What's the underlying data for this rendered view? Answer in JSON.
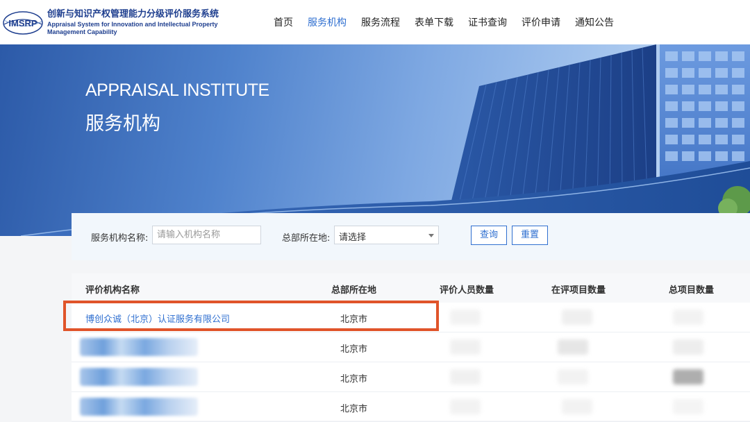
{
  "header": {
    "logo_text": "IMSRP",
    "brand_cn": "创新与知识产权管理能力分级评价服务系统",
    "brand_en_line1": "Appraisal System for Innovation and Intellectual Property",
    "brand_en_line2": "Management Capability",
    "nav": [
      {
        "label": "首页"
      },
      {
        "label": "服务机构"
      },
      {
        "label": "服务流程"
      },
      {
        "label": "表单下载"
      },
      {
        "label": "证书查询"
      },
      {
        "label": "评价申请"
      },
      {
        "label": "通知公告"
      }
    ],
    "active_nav": "服务机构"
  },
  "banner": {
    "title_en": "APPRAISAL INSTITUTE",
    "title_cn": "服务机构"
  },
  "search": {
    "name_label": "服务机构名称:",
    "name_placeholder": "请输入机构名称",
    "location_label": "总部所在地:",
    "location_value": "请选择",
    "query_button": "查询",
    "reset_button": "重置"
  },
  "table": {
    "columns": [
      "评价机构名称",
      "总部所在地",
      "评价人员数量",
      "在评项目数量",
      "总项目数量"
    ],
    "rows": [
      {
        "name": "博创众诚（北京）认证服务有限公司",
        "location": "北京市"
      },
      {
        "name": "",
        "location": "北京市"
      },
      {
        "name": "",
        "location": "北京市"
      },
      {
        "name": "",
        "location": "北京市"
      }
    ]
  },
  "colors": {
    "primary": "#2f6fd0",
    "brand": "#1f3f8f",
    "highlight": "#e0542a"
  }
}
